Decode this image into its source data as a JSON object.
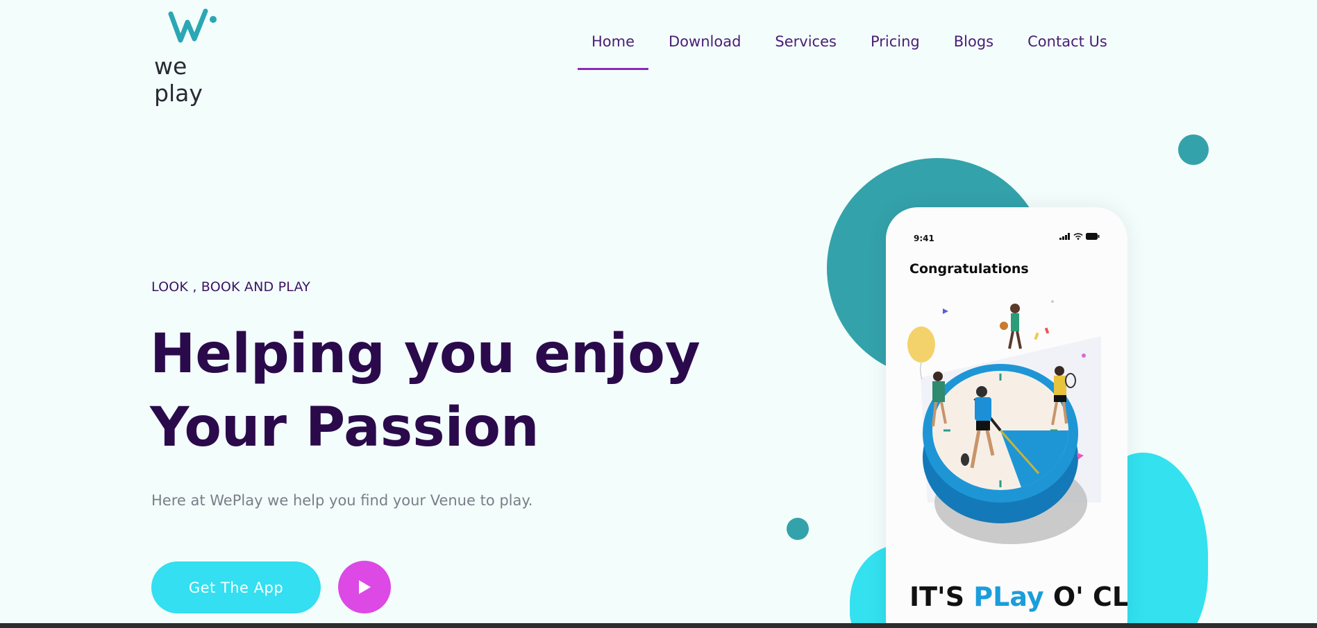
{
  "brand": {
    "logo_text": "we play"
  },
  "nav": {
    "items": [
      "Home",
      "Download",
      "Services",
      "Pricing",
      "Blogs",
      "Contact Us"
    ],
    "active": "Home"
  },
  "hero": {
    "eyebrow": "LOOK , BOOK AND PLAY",
    "headline_line1": "Helping you enjoy",
    "headline_line2": "Your Passion",
    "subtext": "Here at WePlay we help you find your Venue to play.",
    "cta_label": "Get The App"
  },
  "phone": {
    "time": "9:41",
    "heading": "Congratulations",
    "tagline_part1": "IT'S ",
    "tagline_accent": "PLay",
    "tagline_part2": " O' CLOCK"
  },
  "colors": {
    "background": "#f3fdfc",
    "primary_text": "#2b0a4c",
    "nav_text": "#4a1d73",
    "active_underline": "#8f27b8",
    "cta_button": "#33dff0",
    "play_button": "#dc49e5",
    "teal_decor": "#34a2ab",
    "cyan_decor": "#33e1ef"
  },
  "icons": {
    "play_button": "play-icon",
    "logo_mark": "weplay-logo-icon",
    "status": [
      "signal-icon",
      "wifi-icon",
      "battery-icon"
    ]
  }
}
